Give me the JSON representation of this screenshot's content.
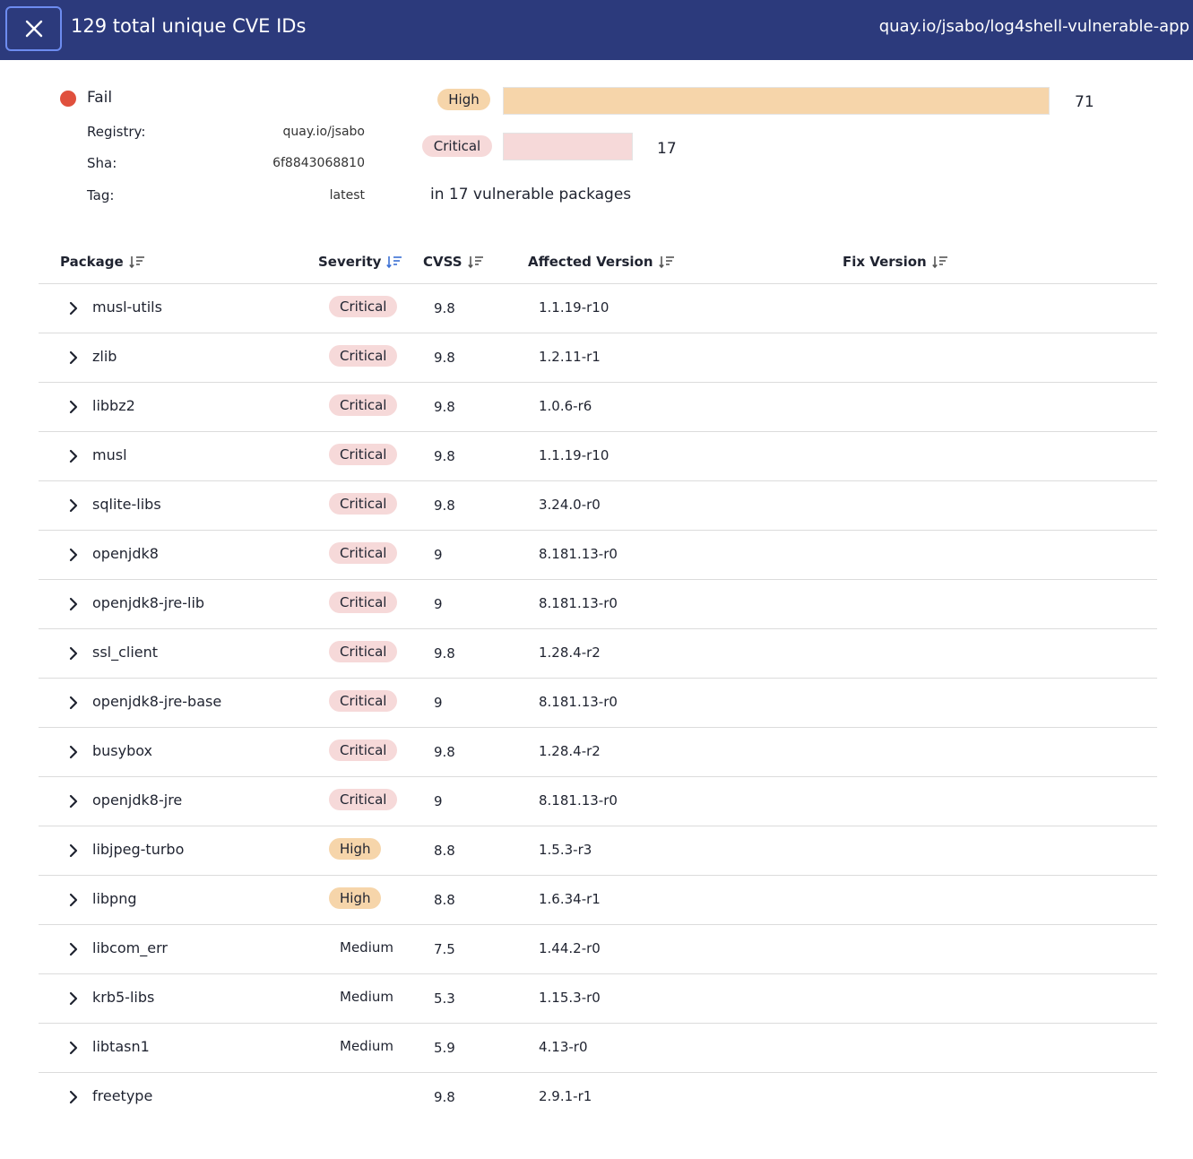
{
  "header": {
    "title": "129 total unique CVE IDs",
    "image": "quay.io/jsabo/log4shell-vulnerable-app"
  },
  "summary": {
    "status": "Fail",
    "status_color": "#e0503d",
    "registry_label": "Registry:",
    "registry_value": "quay.io/jsabo",
    "sha_label": "Sha:",
    "sha_value": "6f8843068810",
    "tag_label": "Tag:",
    "tag_value": "latest",
    "bars": [
      {
        "label": "High",
        "count": "71",
        "color": "#f6d5aa"
      },
      {
        "label": "Critical",
        "count": "17",
        "color": "#f6d9d9"
      }
    ],
    "packages_note": "in 17 vulnerable packages"
  },
  "table": {
    "columns": [
      "Package",
      "Severity",
      "CVSS",
      "Affected Version",
      "Fix Version"
    ],
    "rows": [
      {
        "package": "musl-utils",
        "severity": "Critical",
        "cvss": "9.8",
        "affected": "1.1.19-r10",
        "fix": ""
      },
      {
        "package": "zlib",
        "severity": "Critical",
        "cvss": "9.8",
        "affected": "1.2.11-r1",
        "fix": ""
      },
      {
        "package": "libbz2",
        "severity": "Critical",
        "cvss": "9.8",
        "affected": "1.0.6-r6",
        "fix": ""
      },
      {
        "package": "musl",
        "severity": "Critical",
        "cvss": "9.8",
        "affected": "1.1.19-r10",
        "fix": ""
      },
      {
        "package": "sqlite-libs",
        "severity": "Critical",
        "cvss": "9.8",
        "affected": "3.24.0-r0",
        "fix": ""
      },
      {
        "package": "openjdk8",
        "severity": "Critical",
        "cvss": "9",
        "affected": "8.181.13-r0",
        "fix": ""
      },
      {
        "package": "openjdk8-jre-lib",
        "severity": "Critical",
        "cvss": "9",
        "affected": "8.181.13-r0",
        "fix": ""
      },
      {
        "package": "ssl_client",
        "severity": "Critical",
        "cvss": "9.8",
        "affected": "1.28.4-r2",
        "fix": ""
      },
      {
        "package": "openjdk8-jre-base",
        "severity": "Critical",
        "cvss": "9",
        "affected": "8.181.13-r0",
        "fix": ""
      },
      {
        "package": "busybox",
        "severity": "Critical",
        "cvss": "9.8",
        "affected": "1.28.4-r2",
        "fix": ""
      },
      {
        "package": "openjdk8-jre",
        "severity": "Critical",
        "cvss": "9",
        "affected": "8.181.13-r0",
        "fix": ""
      },
      {
        "package": "libjpeg-turbo",
        "severity": "High",
        "cvss": "8.8",
        "affected": "1.5.3-r3",
        "fix": ""
      },
      {
        "package": "libpng",
        "severity": "High",
        "cvss": "8.8",
        "affected": "1.6.34-r1",
        "fix": ""
      },
      {
        "package": "libcom_err",
        "severity": "Medium",
        "cvss": "7.5",
        "affected": "1.44.2-r0",
        "fix": ""
      },
      {
        "package": "krb5-libs",
        "severity": "Medium",
        "cvss": "5.3",
        "affected": "1.15.3-r0",
        "fix": ""
      },
      {
        "package": "libtasn1",
        "severity": "Medium",
        "cvss": "5.9",
        "affected": "4.13-r0",
        "fix": ""
      },
      {
        "package": "freetype",
        "severity": "",
        "cvss": "9.8",
        "affected": "2.9.1-r1",
        "fix": ""
      }
    ]
  }
}
